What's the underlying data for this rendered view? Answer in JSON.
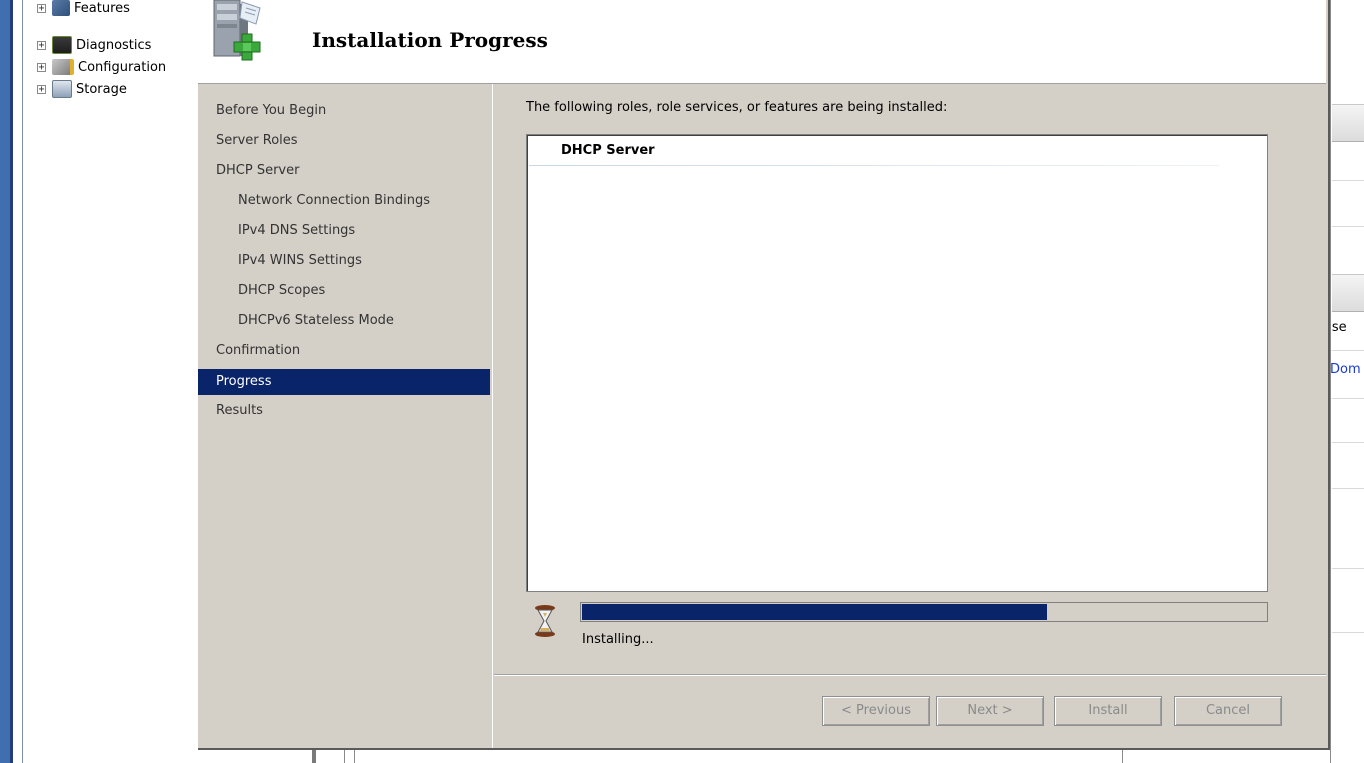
{
  "tree": {
    "items": [
      {
        "label": "Features",
        "expander": "+",
        "icon": "features-icon"
      },
      {
        "label": "Diagnostics",
        "expander": "+",
        "icon": "diagnostics-icon"
      },
      {
        "label": "Configuration",
        "expander": "+",
        "icon": "configuration-icon"
      },
      {
        "label": "Storage",
        "expander": "+",
        "icon": "storage-icon"
      }
    ]
  },
  "dialog": {
    "title": "Installation Progress",
    "header_icon": "server-add-icon"
  },
  "nav": {
    "items": [
      {
        "label": "Before You Begin",
        "level": 0,
        "active": false
      },
      {
        "label": "Server Roles",
        "level": 0,
        "active": false
      },
      {
        "label": "DHCP Server",
        "level": 0,
        "active": false
      },
      {
        "label": "Network Connection Bindings",
        "level": 1,
        "active": false
      },
      {
        "label": "IPv4 DNS Settings",
        "level": 1,
        "active": false
      },
      {
        "label": "IPv4 WINS Settings",
        "level": 1,
        "active": false
      },
      {
        "label": "DHCP Scopes",
        "level": 1,
        "active": false
      },
      {
        "label": "DHCPv6 Stateless Mode",
        "level": 1,
        "active": false
      },
      {
        "label": "Confirmation",
        "level": 0,
        "active": false
      },
      {
        "label": "Progress",
        "level": 0,
        "active": true
      },
      {
        "label": "Results",
        "level": 0,
        "active": false
      }
    ]
  },
  "content": {
    "intro": "The following roles, role services, or features are being installed:",
    "installing_items": [
      "DHCP Server"
    ],
    "progress_fraction": 0.68,
    "status": "Installing...",
    "status_icon": "hourglass-icon"
  },
  "buttons": {
    "previous": "< Previous",
    "next": "Next >",
    "install": "Install",
    "cancel": "Cancel"
  },
  "background_window": {
    "text_fragment_1": "y se",
    "text_fragment_2": "Dom"
  },
  "colors": {
    "selection": "#0a246a",
    "dialog_bg": "#d4d0c8",
    "link": "#1a3ad3"
  }
}
